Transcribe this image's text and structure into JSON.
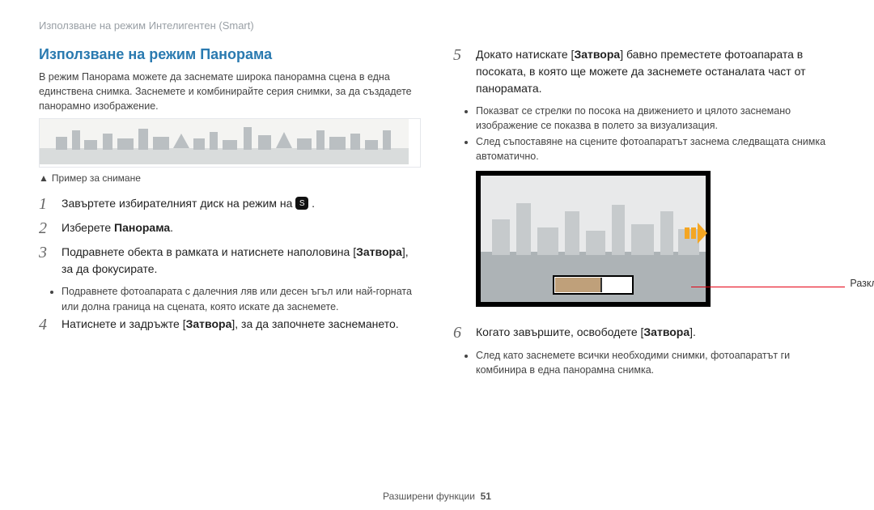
{
  "header": "Използване на режим Интелигентен (Smart)",
  "title": "Използване на режим Панорама",
  "intro": "В режим Панорама можете да заснемате широка панорамна сцена в една единствена снимка. Заснемете и комбинирайте серия снимки, за да създадете панорамно изображение.",
  "caption": "Пример за снимане",
  "dial_letter": "S",
  "steps": {
    "s1_pre": "Завъртете избирателният диск на режим на ",
    "s1_post": " .",
    "s2_pre": "Изберете ",
    "s2_bold": "Панорама",
    "s2_post": ".",
    "s3_pre": "Подравнете обекта в рамката и натиснете наполовина [",
    "s3_bold": "Затвора",
    "s3_post": "], за да фокусирате.",
    "s3_b1": "Подравнете фотоапарата с далечния ляв или десен ъгъл или най-горната или долна граница на сцената, която искате да заснемете.",
    "s4_pre": "Натиснете и задръжте [",
    "s4_bold": "Затвора",
    "s4_post": "], за да започнете заснемането.",
    "s5_pre": "Докато натискате [",
    "s5_bold": "Затвора",
    "s5_post": "] бавно преместете фотоапарата в посоката, в която ще можете да заснемете останалата част от панорамата.",
    "s5_b1": "Показват се стрелки по посока на движението и цялото заснемано изображение се показва в полето за визуализация.",
    "s5_b2": "След съпоставяне на сцените фотоапаратът заснема следващата снимка автоматично.",
    "s6_pre": "Когато завършите, освободете [",
    "s6_bold": "Затвора",
    "s6_post": "].",
    "s6_b1": "След като заснемете всички необходими снимки, фотоапаратът ги комбинира в една панорамна снимка."
  },
  "callout": "Разклащане",
  "footer_section": "Разширени функции",
  "footer_page": "51"
}
